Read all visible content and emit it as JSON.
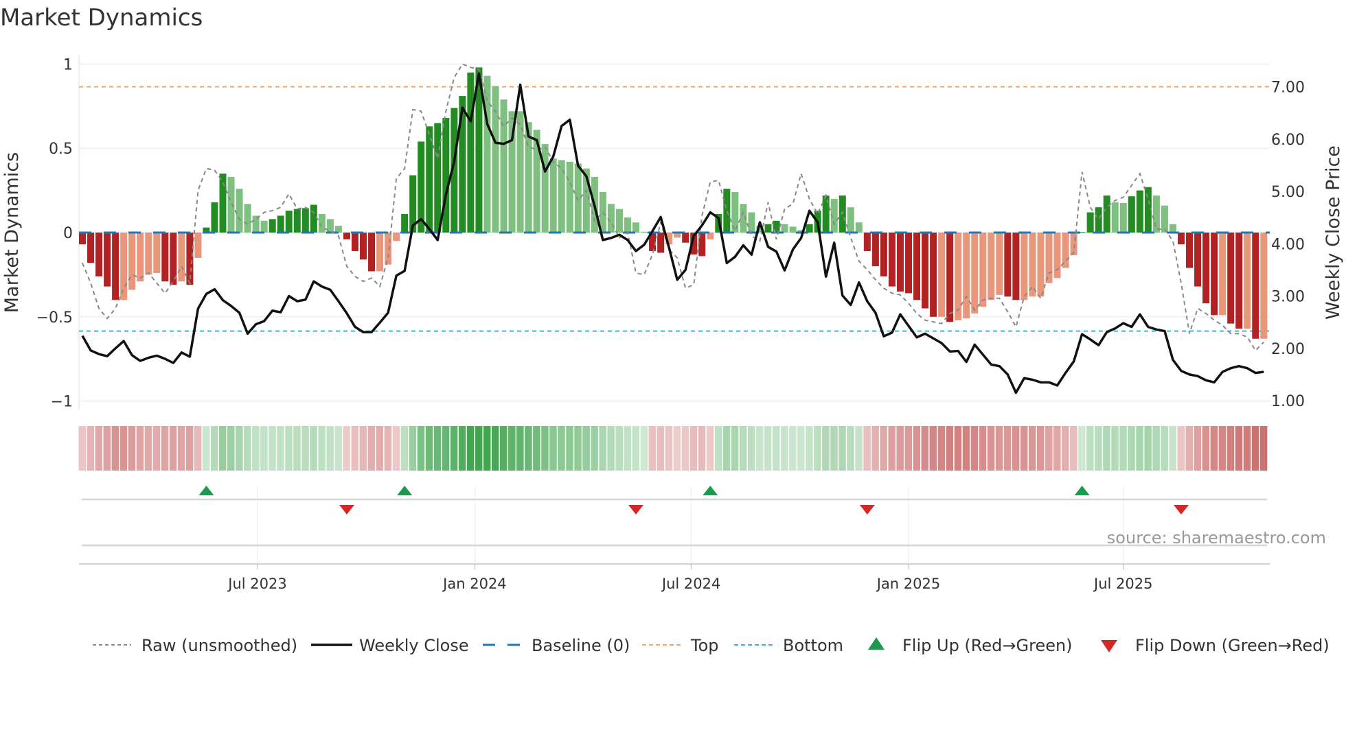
{
  "title": "Market Dynamics",
  "source": "source: sharemaestro.com",
  "chart_data": {
    "type": "bar",
    "title": "Market Dynamics",
    "ylabel": "Market Dynamics",
    "y2label": "Weekly Close Price",
    "ylim": [
      -1,
      1
    ],
    "y2lim": [
      1.0,
      7.4
    ],
    "grid": true,
    "yticks": [
      {
        "v": 1,
        "label": "1"
      },
      {
        "v": 0.5,
        "label": "0.5"
      },
      {
        "v": 0,
        "label": "0"
      },
      {
        "v": -0.5,
        "label": "−0.5"
      },
      {
        "v": -1,
        "label": "−1"
      }
    ],
    "y2ticks": [
      {
        "v": 7,
        "label": "7.00"
      },
      {
        "v": 6,
        "label": "6.00"
      },
      {
        "v": 5,
        "label": "5.00"
      },
      {
        "v": 4,
        "label": "4.00"
      },
      {
        "v": 3,
        "label": "3.00"
      },
      {
        "v": 2,
        "label": "2.00"
      },
      {
        "v": 1,
        "label": "1.00"
      }
    ],
    "x_unit": "week index",
    "xticks": [
      {
        "week": 21.2,
        "label": "Jul 2023"
      },
      {
        "week": 47.5,
        "label": "Jan 2024"
      },
      {
        "week": 73.7,
        "label": "Jul 2024"
      },
      {
        "week": 100,
        "label": "Jan 2025"
      },
      {
        "week": 126,
        "label": "Jul 2025"
      }
    ],
    "top_level": 0.865,
    "bottom_level": -0.585,
    "baseline": 0,
    "market_dynamics": [
      -0.07,
      -0.18,
      -0.26,
      -0.32,
      -0.4,
      -0.4,
      -0.34,
      -0.29,
      -0.25,
      -0.24,
      -0.29,
      -0.31,
      -0.29,
      -0.31,
      -0.15,
      0.03,
      0.18,
      0.35,
      0.33,
      0.26,
      0.17,
      0.1,
      0.07,
      0.08,
      0.1,
      0.13,
      0.14,
      0.145,
      0.165,
      0.11,
      0.08,
      0.04,
      -0.04,
      -0.11,
      -0.16,
      -0.23,
      -0.23,
      -0.19,
      -0.05,
      0.11,
      0.34,
      0.54,
      0.63,
      0.65,
      0.68,
      0.74,
      0.81,
      0.95,
      0.98,
      0.93,
      0.87,
      0.79,
      0.72,
      0.72,
      0.655,
      0.61,
      0.525,
      0.44,
      0.43,
      0.42,
      0.41,
      0.38,
      0.33,
      0.24,
      0.17,
      0.14,
      0.09,
      0.06,
      0.005,
      -0.11,
      -0.12,
      -0.07,
      -0.03,
      -0.06,
      -0.13,
      -0.14,
      -0.04,
      0.11,
      0.26,
      0.24,
      0.17,
      0.12,
      0.04,
      0.05,
      0.07,
      0.05,
      0.035,
      0.015,
      0.05,
      0.13,
      0.22,
      0.2,
      0.22,
      0.15,
      0.06,
      -0.11,
      -0.2,
      -0.26,
      -0.32,
      -0.35,
      -0.36,
      -0.4,
      -0.45,
      -0.5,
      -0.5,
      -0.53,
      -0.52,
      -0.51,
      -0.48,
      -0.44,
      -0.4,
      -0.37,
      -0.38,
      -0.4,
      -0.4,
      -0.38,
      -0.38,
      -0.3,
      -0.27,
      -0.21,
      -0.135,
      0.003,
      0.12,
      0.15,
      0.22,
      0.18,
      0.175,
      0.215,
      0.25,
      0.27,
      0.22,
      0.16,
      0.05,
      -0.07,
      -0.21,
      -0.32,
      -0.42,
      -0.49,
      -0.49,
      -0.54,
      -0.57,
      -0.57,
      -0.63,
      -0.63
    ],
    "raw": [
      -0.18,
      -0.3,
      -0.45,
      -0.51,
      -0.45,
      -0.33,
      -0.25,
      -0.27,
      -0.24,
      -0.3,
      -0.36,
      -0.29,
      -0.2,
      -0.3,
      0.25,
      0.38,
      0.37,
      0.3,
      0.18,
      0.08,
      0.05,
      0.08,
      0.12,
      0.13,
      0.15,
      0.23,
      0.14,
      0.15,
      0.12,
      0.03,
      0.01,
      -0.02,
      -0.2,
      -0.26,
      -0.29,
      -0.27,
      -0.32,
      -0.15,
      0.32,
      0.38,
      0.73,
      0.72,
      0.58,
      0.44,
      0.72,
      0.92,
      1.0,
      0.98,
      0.97,
      0.78,
      0.72,
      0.63,
      0.68,
      0.64,
      0.51,
      0.49,
      0.51,
      0.42,
      0.38,
      0.3,
      0.19,
      0.25,
      0.07,
      0.12,
      0.06,
      -0.03,
      0.0,
      -0.24,
      -0.25,
      -0.13,
      0.06,
      -0.1,
      -0.15,
      -0.33,
      -0.31,
      0.1,
      0.3,
      0.31,
      0.13,
      0.01,
      0.12,
      -0.02,
      -0.05,
      0.18,
      -0.04,
      0.14,
      0.17,
      0.35,
      0.2,
      0.11,
      0.22,
      0.05,
      0.12,
      -0.03,
      -0.17,
      -0.22,
      -0.28,
      -0.33,
      -0.36,
      -0.37,
      -0.42,
      -0.48,
      -0.52,
      -0.53,
      -0.54,
      -0.48,
      -0.46,
      -0.38,
      -0.46,
      -0.4,
      -0.39,
      -0.39,
      -0.47,
      -0.56,
      -0.38,
      -0.32,
      -0.39,
      -0.24,
      -0.22,
      -0.17,
      -0.12,
      0.36,
      0.15,
      0.08,
      0.15,
      0.19,
      0.21,
      0.28,
      0.35,
      0.2,
      0.02,
      0.02,
      -0.05,
      -0.3,
      -0.6,
      -0.45,
      -0.48,
      -0.52,
      -0.55,
      -0.6,
      -0.6,
      -0.62,
      -0.7,
      -0.65
    ],
    "weekly_close": [
      2.24,
      1.96,
      1.89,
      1.85,
      2.0,
      2.14,
      1.87,
      1.76,
      1.82,
      1.86,
      1.8,
      1.72,
      1.92,
      1.84,
      2.76,
      3.04,
      3.13,
      2.92,
      2.81,
      2.68,
      2.28,
      2.46,
      2.52,
      2.72,
      2.69,
      3.0,
      2.9,
      2.93,
      3.28,
      3.18,
      3.12,
      2.9,
      2.67,
      2.41,
      2.31,
      2.31,
      2.49,
      2.68,
      3.39,
      3.48,
      4.35,
      4.47,
      4.28,
      4.07,
      4.94,
      5.57,
      6.6,
      6.34,
      7.25,
      6.29,
      5.93,
      5.91,
      5.98,
      7.04,
      6.05,
      5.98,
      5.38,
      5.67,
      6.25,
      6.37,
      5.49,
      5.29,
      4.72,
      4.07,
      4.11,
      4.17,
      4.07,
      3.86,
      3.98,
      4.24,
      4.51,
      3.93,
      3.31,
      3.5,
      4.15,
      4.35,
      4.6,
      4.49,
      3.63,
      3.75,
      3.97,
      3.79,
      4.41,
      3.94,
      3.85,
      3.49,
      3.89,
      4.11,
      4.63,
      4.41,
      3.37,
      4.02,
      3.01,
      2.83,
      3.26,
      2.9,
      2.68,
      2.23,
      2.3,
      2.65,
      2.43,
      2.21,
      2.28,
      2.19,
      2.1,
      1.94,
      1.95,
      1.74,
      2.07,
      1.88,
      1.69,
      1.66,
      1.5,
      1.15,
      1.43,
      1.4,
      1.35,
      1.35,
      1.29,
      1.53,
      1.75,
      2.27,
      2.17,
      2.06,
      2.31,
      2.38,
      2.48,
      2.41,
      2.65,
      2.41,
      2.36,
      2.33,
      1.78,
      1.57,
      1.5,
      1.47,
      1.39,
      1.35,
      1.55,
      1.62,
      1.66,
      1.62,
      1.53,
      1.55
    ],
    "flip_up_weeks": [
      15,
      39,
      76,
      121
    ],
    "flip_down_weeks": [
      32,
      67,
      95,
      133
    ],
    "colors": {
      "bar_up_strong": "#228b22",
      "bar_up_weak": "#7fbf7f",
      "bar_down_strong": "#b22222",
      "bar_down_weak": "#e9967a",
      "raw": "#888888",
      "close": "#111111",
      "baseline": "#1f77b4",
      "top": "#f4a261",
      "bottom": "#22c3d6",
      "flip_up": "#1a9a4a",
      "flip_down": "#d62728"
    },
    "legend_position": "bottom",
    "legend": [
      {
        "key": "raw",
        "label": "Raw (unsmoothed)"
      },
      {
        "key": "close",
        "label": "Weekly Close"
      },
      {
        "key": "baseline",
        "label": "Baseline (0)"
      },
      {
        "key": "top",
        "label": "Top"
      },
      {
        "key": "bottom",
        "label": "Bottom"
      },
      {
        "key": "flip_up",
        "label": "Flip Up (Red→Green)"
      },
      {
        "key": "flip_down",
        "label": "Flip Down (Green→Red)"
      }
    ]
  }
}
